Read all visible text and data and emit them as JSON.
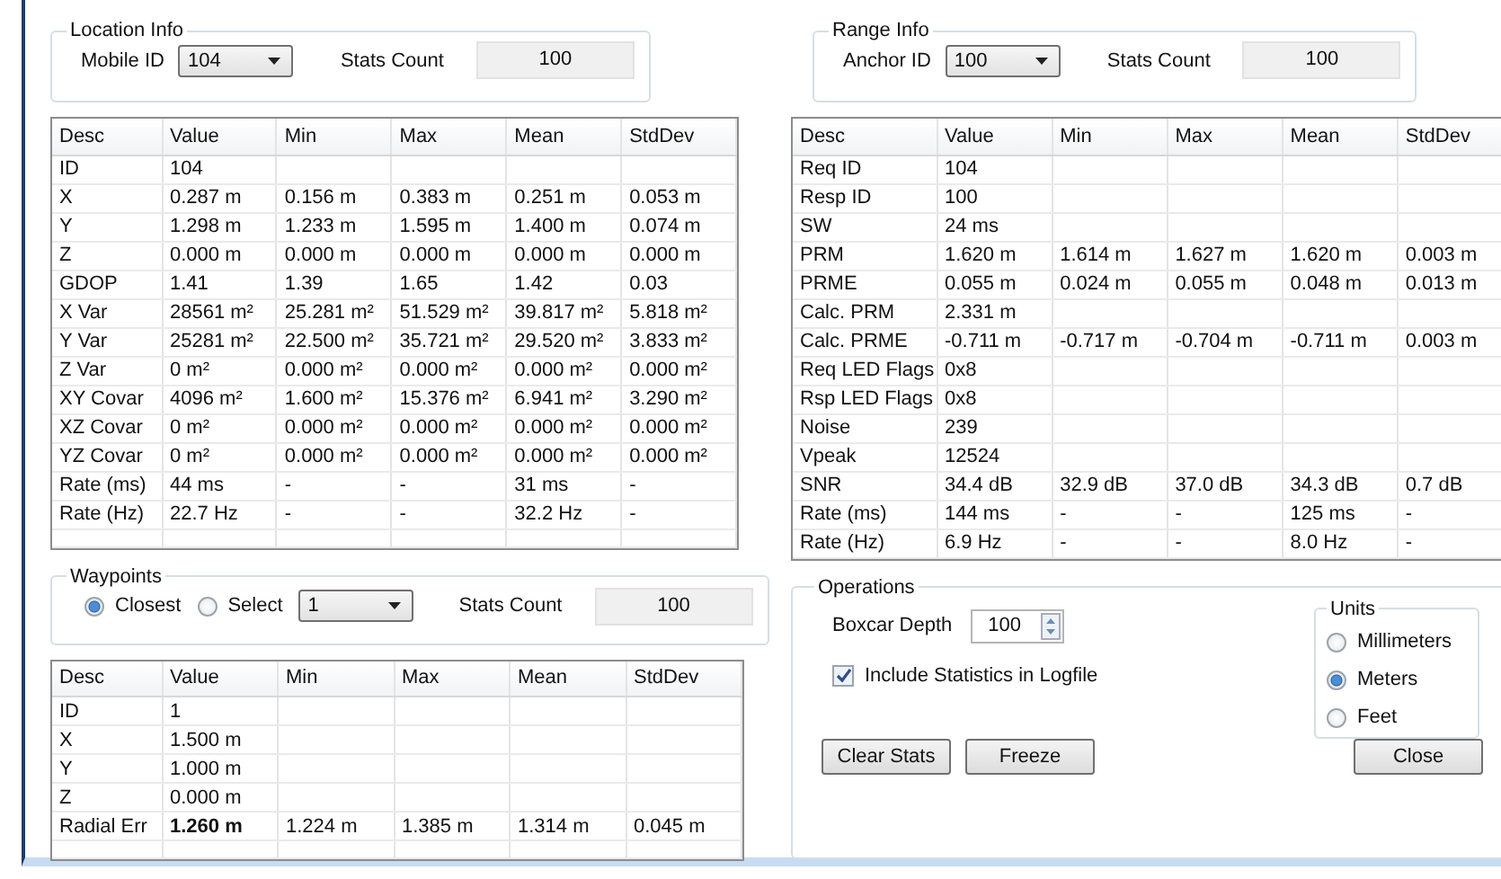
{
  "location_info": {
    "title": "Location Info",
    "id_label": "Mobile ID",
    "id_value": "104",
    "stats_label": "Stats Count",
    "stats_value": "100"
  },
  "location_table": {
    "columns": [
      "Desc",
      "Value",
      "Min",
      "Max",
      "Mean",
      "StdDev"
    ],
    "rows": [
      {
        "cells": [
          "ID",
          "104",
          "",
          "",
          "",
          ""
        ],
        "emphasis": false
      },
      {
        "cells": [
          "X",
          "0.287 m",
          "0.156 m",
          "0.383 m",
          "0.251 m",
          "0.053 m"
        ],
        "emphasis": false
      },
      {
        "cells": [
          "Y",
          "1.298 m",
          "1.233 m",
          "1.595 m",
          "1.400 m",
          "0.074 m"
        ],
        "emphasis": false
      },
      {
        "cells": [
          "Z",
          "0.000 m",
          "0.000 m",
          "0.000 m",
          "0.000 m",
          "0.000 m"
        ],
        "emphasis": false
      },
      {
        "cells": [
          "GDOP",
          "1.41",
          "1.39",
          "1.65",
          "1.42",
          "0.03"
        ],
        "emphasis": false
      },
      {
        "cells": [
          "X Var",
          "28561 m²",
          "25.281 m²",
          "51.529 m²",
          "39.817 m²",
          "5.818 m²"
        ],
        "emphasis": false
      },
      {
        "cells": [
          "Y Var",
          "25281 m²",
          "22.500 m²",
          "35.721 m²",
          "29.520 m²",
          "3.833 m²"
        ],
        "emphasis": false
      },
      {
        "cells": [
          "Z Var",
          "0 m²",
          "0.000 m²",
          "0.000 m²",
          "0.000 m²",
          "0.000 m²"
        ],
        "emphasis": false
      },
      {
        "cells": [
          "XY Covar",
          "4096 m²",
          "1.600 m²",
          "15.376 m²",
          "6.941 m²",
          "3.290 m²"
        ],
        "emphasis": false
      },
      {
        "cells": [
          "XZ Covar",
          "0 m²",
          "0.000 m²",
          "0.000 m²",
          "0.000 m²",
          "0.000 m²"
        ],
        "emphasis": false
      },
      {
        "cells": [
          "YZ Covar",
          "0 m²",
          "0.000 m²",
          "0.000 m²",
          "0.000 m²",
          "0.000 m²"
        ],
        "emphasis": false
      },
      {
        "cells": [
          "Rate (ms)",
          "44 ms",
          "-",
          "-",
          "31 ms",
          "-"
        ],
        "emphasis": false
      },
      {
        "cells": [
          "Rate (Hz)",
          "22.7 Hz",
          "-",
          "-",
          "32.2 Hz",
          "-"
        ],
        "emphasis": false
      }
    ]
  },
  "range_info": {
    "title": "Range Info",
    "id_label": "Anchor ID",
    "id_value": "100",
    "stats_label": "Stats Count",
    "stats_value": "100"
  },
  "range_table": {
    "columns": [
      "Desc",
      "Value",
      "Min",
      "Max",
      "Mean",
      "StdDev"
    ],
    "rows": [
      {
        "cells": [
          "Req ID",
          "104",
          "",
          "",
          "",
          ""
        ],
        "emphasis": false
      },
      {
        "cells": [
          "Resp ID",
          "100",
          "",
          "",
          "",
          ""
        ],
        "emphasis": false
      },
      {
        "cells": [
          "SW",
          "24 ms",
          "",
          "",
          "",
          ""
        ],
        "emphasis": false
      },
      {
        "cells": [
          "PRM",
          "1.620 m",
          "1.614 m",
          "1.627 m",
          "1.620 m",
          "0.003 m"
        ],
        "emphasis": false
      },
      {
        "cells": [
          "PRME",
          "0.055 m",
          "0.024 m",
          "0.055 m",
          "0.048 m",
          "0.013 m"
        ],
        "emphasis": false
      },
      {
        "cells": [
          "Calc. PRM",
          "2.331 m",
          "",
          "",
          "",
          ""
        ],
        "emphasis": false
      },
      {
        "cells": [
          "Calc. PRME",
          "-0.711 m",
          "-0.717 m",
          "-0.704 m",
          "-0.711 m",
          "0.003 m"
        ],
        "emphasis": false
      },
      {
        "cells": [
          "Req LED Flags",
          "0x8",
          "",
          "",
          "",
          ""
        ],
        "emphasis": false
      },
      {
        "cells": [
          "Rsp LED Flags",
          "0x8",
          "",
          "",
          "",
          ""
        ],
        "emphasis": false
      },
      {
        "cells": [
          "Noise",
          "239",
          "",
          "",
          "",
          ""
        ],
        "emphasis": false
      },
      {
        "cells": [
          "Vpeak",
          "12524",
          "",
          "",
          "",
          ""
        ],
        "emphasis": false
      },
      {
        "cells": [
          "SNR",
          "34.4 dB",
          "32.9 dB",
          "37.0 dB",
          "34.3 dB",
          "0.7 dB"
        ],
        "emphasis": false
      },
      {
        "cells": [
          "Rate (ms)",
          "144 ms",
          "-",
          "-",
          "125 ms",
          "-"
        ],
        "emphasis": false
      },
      {
        "cells": [
          "Rate (Hz)",
          "6.9 Hz",
          "-",
          "-",
          "8.0 Hz",
          "-"
        ],
        "emphasis": false
      }
    ]
  },
  "waypoints": {
    "title": "Waypoints",
    "modes": [
      {
        "label": "Closest",
        "selected": true
      },
      {
        "label": "Select",
        "selected": false
      }
    ],
    "select_value": "1",
    "stats_label": "Stats Count",
    "stats_value": "100"
  },
  "waypoint_table": {
    "columns": [
      "Desc",
      "Value",
      "Min",
      "Max",
      "Mean",
      "StdDev"
    ],
    "rows": [
      {
        "cells": [
          "ID",
          "1",
          "",
          "",
          "",
          ""
        ],
        "emphasis": false
      },
      {
        "cells": [
          "X",
          "1.500 m",
          "",
          "",
          "",
          ""
        ],
        "emphasis": false
      },
      {
        "cells": [
          "Y",
          "1.000 m",
          "",
          "",
          "",
          ""
        ],
        "emphasis": false
      },
      {
        "cells": [
          "Z",
          "0.000 m",
          "",
          "",
          "",
          ""
        ],
        "emphasis": false
      },
      {
        "cells": [
          "Radial Err",
          "1.260 m",
          "1.224 m",
          "1.385 m",
          "1.314 m",
          "0.045 m"
        ],
        "emphasis": true
      }
    ]
  },
  "operations": {
    "title": "Operations",
    "boxcar_label": "Boxcar Depth",
    "boxcar_value": "100",
    "include_stats": {
      "label": "Include Statistics in Logfile",
      "checked": true
    },
    "units": {
      "title": "Units",
      "options": [
        {
          "label": "Millimeters",
          "selected": false
        },
        {
          "label": "Meters",
          "selected": true
        },
        {
          "label": "Feet",
          "selected": false
        }
      ]
    },
    "buttons": [
      "Clear Stats",
      "Freeze",
      "Close"
    ]
  }
}
